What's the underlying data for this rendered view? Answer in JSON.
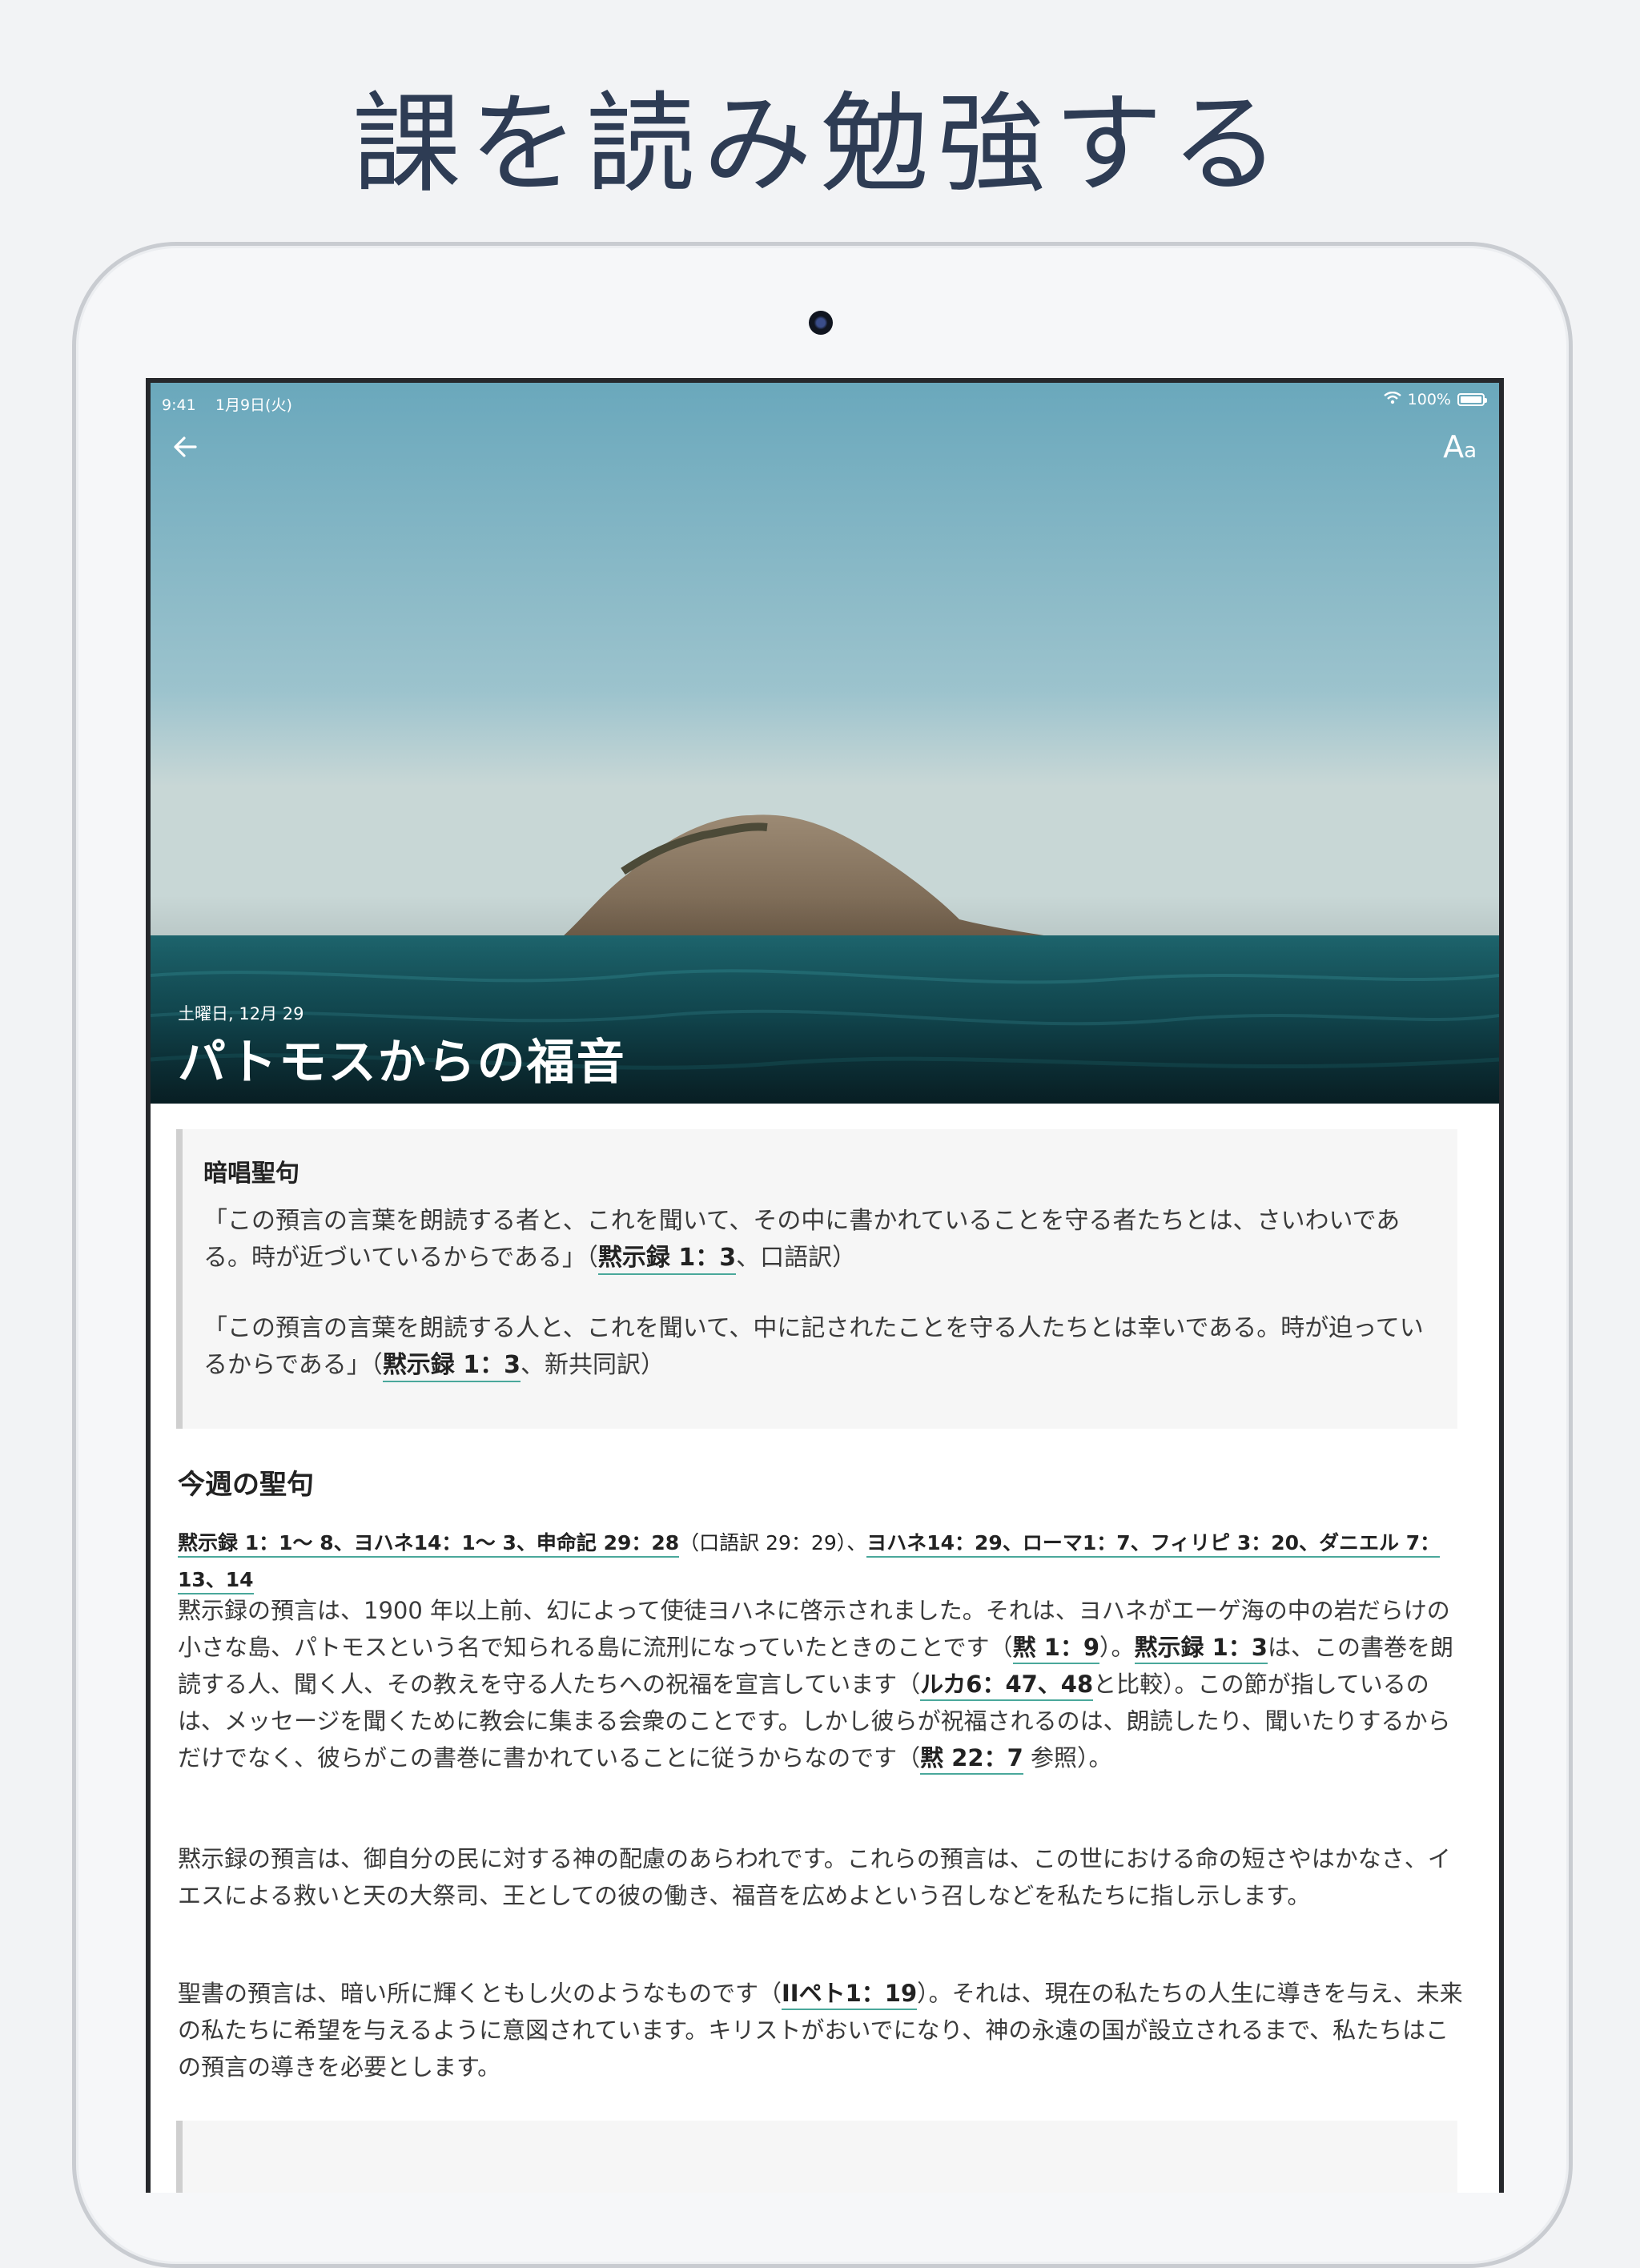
{
  "headline": "課を読み勉強する",
  "status": {
    "time": "9:41",
    "date": "1月9日(火)",
    "battery": "100%"
  },
  "toolbar": {
    "font_label_big": "A",
    "font_label_small": "a"
  },
  "lesson": {
    "date": "土曜日, 12月 29",
    "title": "パトモスからの福音"
  },
  "memory": {
    "title": "暗唱聖句",
    "verse1_text": "「この預言の言葉を朗読する者と、これを聞いて、その中に書かれていることを守る者たちとは、さいわいである。時が近づいているからである」（",
    "verse1_ref": "黙示録 1：3",
    "verse1_tail": "、口語訳）",
    "verse2_text": "「この預言の言葉を朗読する人と、これを聞いて、中に記されたことを守る人たちとは幸いである。時が迫っているからである」（",
    "verse2_ref": "黙示録 1：3",
    "verse2_tail": "、新共同訳）"
  },
  "weekly": {
    "title": "今週の聖句",
    "ref1": "黙示録 1：1〜 8、ヨハネ14：1〜 3、申命記 29：28",
    "mid": "（口語訳 29：29）、",
    "ref2": "ヨハネ14：29、ローマ1：7、フィリピ 3：20、ダニエル 7：13、14"
  },
  "body": {
    "p1_a": "黙示録の預言は、1900 年以上前、幻によって使徒ヨハネに啓示されました。それは、ヨハネがエーゲ海の中の岩だらけの小さな島、パトモスという名で知られる島に流刑になっていたときのことです（",
    "p1_ref1": "黙 1：9",
    "p1_b": "）。",
    "p1_ref2": "黙示録 1：3",
    "p1_c": "は、この書巻を朗読する人、聞く人、その教えを守る人たちへの祝福を宣言しています（",
    "p1_ref3": "ルカ6：47、48",
    "p1_d": "と比較）。この節が指しているのは、メッセージを聞くために教会に集まる会衆のことです。しかし彼らが祝福されるのは、朗読したり、聞いたりするからだけでなく、彼らがこの書巻に書かれていることに従うからなのです（",
    "p1_ref4": "黙 22：7",
    "p1_e": " 参照）。",
    "p2": "黙示録の預言は、御自分の民に対する神の配慮のあらわれです。これらの預言は、この世における命の短さやはかなさ、イエスによる救いと天の大祭司、王としての彼の働き、福音を広めよという召しなどを私たちに指し示します。",
    "p3_a": "聖書の預言は、暗い所に輝くともし火のようなものです（",
    "p3_ref": "IIペト1：19",
    "p3_b": "）。それは、現在の私たちの人生に導きを与え、未来の私たちに希望を与えるように意図されています。キリストがおいでになり、神の永遠の国が設立されるまで、私たちはこの預言の導きを必要とします。"
  }
}
